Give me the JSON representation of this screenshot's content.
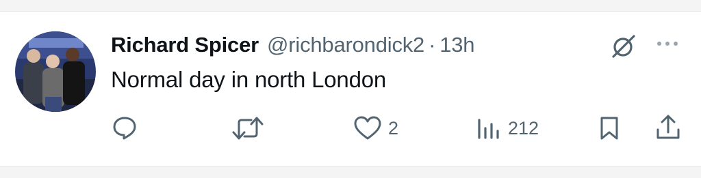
{
  "tweet": {
    "author_name": "Richard Spicer",
    "handle": "@richbarondick2",
    "separator": "·",
    "time": "13h",
    "text": "Normal day in north London"
  },
  "actions": {
    "reply_icon": "speech-bubble-icon",
    "retweet_icon": "retweet-arrows-icon",
    "like_icon": "heart-icon",
    "like_count": "2",
    "views_icon": "bar-chart-icon",
    "view_count": "212",
    "bookmark_icon": "bookmark-icon",
    "share_icon": "share-upload-icon"
  },
  "header_icons": {
    "grok_icon": "slashed-circle-icon",
    "more_icon": "ellipsis-icon"
  },
  "colors": {
    "text_primary": "#0f1419",
    "text_secondary": "#536471",
    "background": "#ffffff",
    "band": "#f4f4f4"
  }
}
